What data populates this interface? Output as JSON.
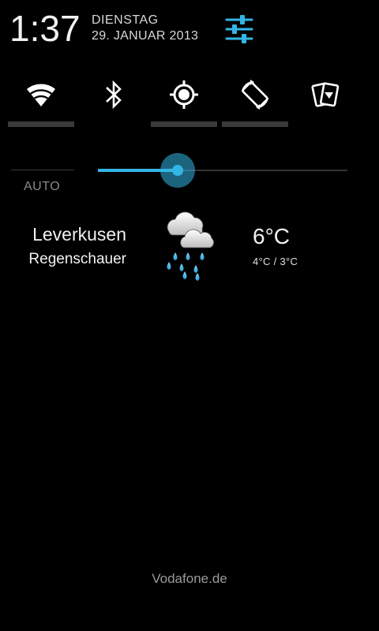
{
  "header": {
    "time": "1:37",
    "weekday": "DIENSTAG",
    "date": "29. JANUAR 2013",
    "settings_icon": "settings-sliders-icon",
    "accent_color": "#33b5e5"
  },
  "quick_settings": {
    "toggles": [
      {
        "name": "wifi",
        "icon": "wifi-icon"
      },
      {
        "name": "bluetooth",
        "icon": "bluetooth-icon"
      },
      {
        "name": "gps",
        "icon": "gps-icon"
      },
      {
        "name": "auto-rotate",
        "icon": "rotate-icon"
      },
      {
        "name": "sync",
        "icon": "sync-cards-icon"
      }
    ]
  },
  "brightness": {
    "auto_label": "AUTO",
    "level": 0.32
  },
  "weather": {
    "city": "Leverkusen",
    "condition": "Regenschauer",
    "temperature": "6°C",
    "range": "4°C / 3°C",
    "icon": "rain-showers-icon"
  },
  "footer": {
    "carrier": "Vodafone.de"
  }
}
